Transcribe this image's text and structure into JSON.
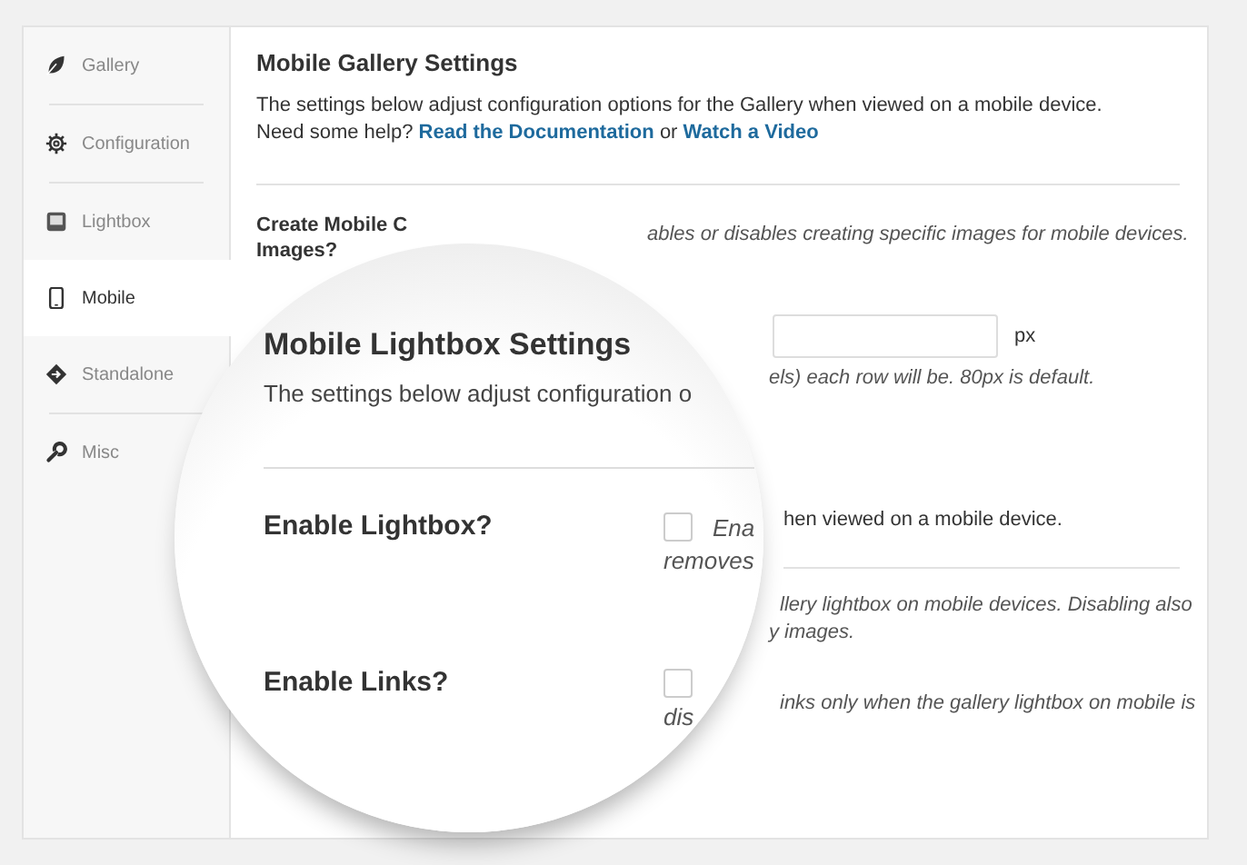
{
  "sidebar": [
    {
      "label": "Gallery",
      "selected": false
    },
    {
      "label": "Configuration",
      "selected": false
    },
    {
      "label": "Lightbox",
      "selected": false
    },
    {
      "label": "Mobile",
      "selected": true
    },
    {
      "label": "Standalone",
      "selected": false
    },
    {
      "label": "Misc",
      "selected": false
    }
  ],
  "header": {
    "title": "Mobile Gallery Settings",
    "description": "The settings below adjust configuration options for the Gallery when viewed on a mobile device.",
    "help": {
      "text": "Need some help?",
      "links": [
        "Read the Documentation",
        "Watch a Video"
      ],
      "joiner": "or"
    }
  },
  "rows": [
    {
      "kind": "label",
      "label_lines": [
        "Create Mobile C",
        "Images?"
      ],
      "description": "ables or disables creating specific images for mobile devices."
    },
    {
      "kind": "input",
      "unit": "px",
      "help": "els) each row will be. 80px is default."
    },
    {
      "kind": "text",
      "lines": [
        "hen viewed on a mobile device."
      ]
    },
    {
      "kind": "divider"
    },
    {
      "kind": "text",
      "lines": [
        "llery lightbox on mobile devices. Disabling also",
        "y images."
      ]
    },
    {
      "kind": "text",
      "lines": [
        "inks only when the gallery lightbox on mobile is"
      ]
    }
  ],
  "magnifier": {
    "title": "Mobile Lightbox Settings",
    "description": "The settings below adjust configuration o",
    "settings": [
      {
        "label": "Enable Lightbox?",
        "checked": false,
        "text": "Ena",
        "continuation": "removes"
      },
      {
        "label": "Enable Links?",
        "checked": false,
        "continuation": "dis"
      }
    ]
  }
}
